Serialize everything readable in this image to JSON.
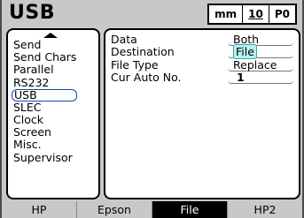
{
  "header": {
    "title": "USB",
    "unit": "mm",
    "number": "10",
    "preset": "P0"
  },
  "menu": {
    "items": [
      "Send",
      "Send Chars",
      "Parallel",
      "RS232",
      "USB",
      "SLEC",
      "Clock",
      "Screen",
      "Misc.",
      "Supervisor"
    ],
    "selected_index": 4
  },
  "fields": {
    "data": {
      "label": "Data",
      "value": "Both"
    },
    "destination": {
      "label": "Destination",
      "value": "File"
    },
    "file_type": {
      "label": "File Type",
      "value": "Replace"
    },
    "cur_auto_no": {
      "label": "Cur Auto No.",
      "value": "1"
    }
  },
  "tabs": [
    "HP",
    "Epson",
    "File",
    "HP2"
  ],
  "active_tab_index": 2,
  "colors": {
    "background": "#c8c8c8",
    "active_tab": "#000000",
    "highlight": "#b7f0f0",
    "selection_border": "#0a4ab0"
  }
}
